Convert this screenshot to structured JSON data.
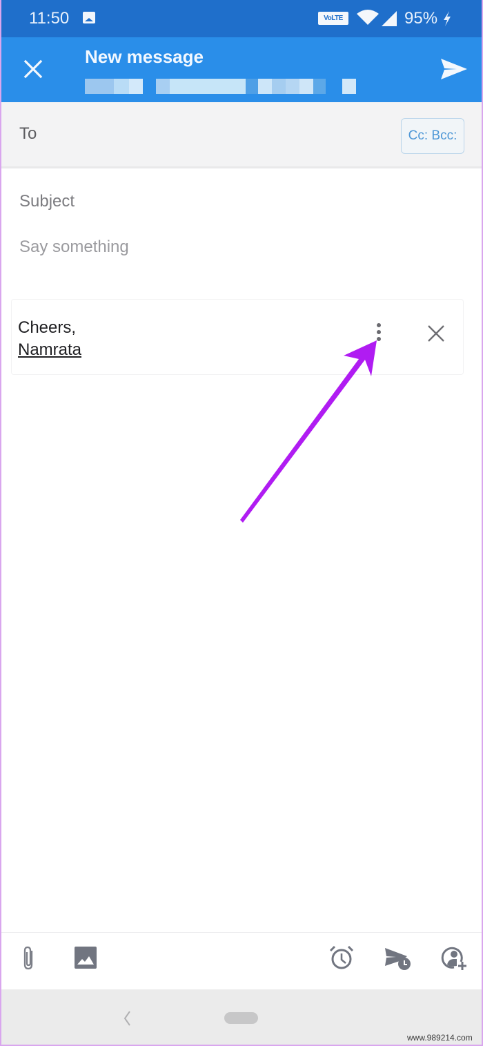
{
  "status_bar": {
    "time": "11:50",
    "notification_icon": "gallery-icon",
    "volte_label": "VoLTE",
    "battery": "95%",
    "icons": [
      "volte-icon",
      "wifi-icon",
      "signal-icon",
      "charging-bolt-icon"
    ]
  },
  "app_bar": {
    "title": "New message",
    "subtitle_redacted": true,
    "close_icon": "close-icon",
    "send_icon": "send-icon",
    "colors": {
      "status_bar": "#1f6fcb",
      "app_bar": "#2a8ee9"
    }
  },
  "compose": {
    "to_label": "To",
    "cc_bcc_label": "Cc: Bcc:",
    "subject_placeholder": "Subject",
    "body_placeholder": "Say something"
  },
  "signature": {
    "line1": "Cheers,",
    "line2": "Namrata",
    "more_icon": "more-vert-icon",
    "remove_icon": "close-icon"
  },
  "annotation": {
    "type": "arrow",
    "color": "#b01cf2",
    "points_to": "signature-more-button"
  },
  "toolbar": {
    "left": [
      "attach-icon",
      "image-icon"
    ],
    "right": [
      "reminder-alarm-icon",
      "schedule-send-icon",
      "add-contact-icon"
    ]
  },
  "nav_bar": {
    "back_icon": "back-chevron-icon",
    "home_pill": "home-pill"
  },
  "watermark": "www.989214.com"
}
